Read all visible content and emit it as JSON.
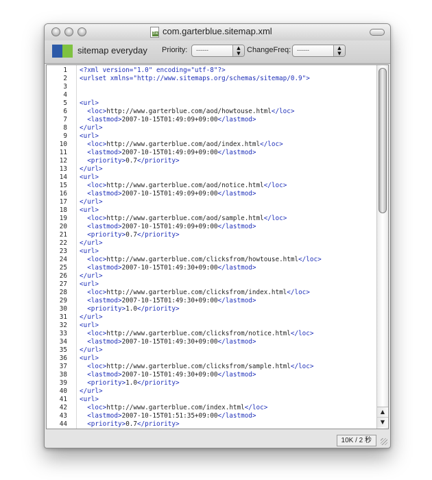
{
  "window": {
    "title": "com.garterblue.sitemap.xml",
    "doc_icon_label": "Dw"
  },
  "toolbar": {
    "app_name": "sitemap everyday",
    "priority_label": "Priority:",
    "priority_value": "------",
    "changefreq_label": "ChangeFreq:",
    "changefreq_value": "------"
  },
  "colors": {
    "logo_blue": "#2d5aa8",
    "logo_green": "#7fc241",
    "xml_tag": "#1d2fb8"
  },
  "editor": {
    "line_numbers": [
      "1",
      "2",
      "3",
      "4",
      "5",
      "6",
      "7",
      "8",
      "9",
      "10",
      "11",
      "12",
      "13",
      "14",
      "15",
      "16",
      "17",
      "18",
      "19",
      "20",
      "21",
      "22",
      "23",
      "24",
      "25",
      "26",
      "27",
      "28",
      "29",
      "30",
      "31",
      "32",
      "33",
      "34",
      "35",
      "36",
      "37",
      "38",
      "39",
      "40",
      "41",
      "42",
      "43",
      "44"
    ],
    "lines": [
      "<?xml version=\"1.0\" encoding=\"utf-8\"?>",
      "<urlset xmlns=\"http://www.sitemaps.org/schemas/sitemap/0.9\">",
      "",
      "",
      "<url>",
      "  <loc>http://www.garterblue.com/aod/howtouse.html</loc>",
      "  <lastmod>2007-10-15T01:49:09+09:00</lastmod>",
      "</url>",
      "<url>",
      "  <loc>http://www.garterblue.com/aod/index.html</loc>",
      "  <lastmod>2007-10-15T01:49:09+09:00</lastmod>",
      "  <priority>0.7</priority>",
      "</url>",
      "<url>",
      "  <loc>http://www.garterblue.com/aod/notice.html</loc>",
      "  <lastmod>2007-10-15T01:49:09+09:00</lastmod>",
      "</url>",
      "<url>",
      "  <loc>http://www.garterblue.com/aod/sample.html</loc>",
      "  <lastmod>2007-10-15T01:49:09+09:00</lastmod>",
      "  <priority>0.7</priority>",
      "</url>",
      "<url>",
      "  <loc>http://www.garterblue.com/clicksfrom/howtouse.html</loc>",
      "  <lastmod>2007-10-15T01:49:30+09:00</lastmod>",
      "</url>",
      "<url>",
      "  <loc>http://www.garterblue.com/clicksfrom/index.html</loc>",
      "  <lastmod>2007-10-15T01:49:30+09:00</lastmod>",
      "  <priority>1.0</priority>",
      "</url>",
      "<url>",
      "  <loc>http://www.garterblue.com/clicksfrom/notice.html</loc>",
      "  <lastmod>2007-10-15T01:49:30+09:00</lastmod>",
      "</url>",
      "<url>",
      "  <loc>http://www.garterblue.com/clicksfrom/sample.html</loc>",
      "  <lastmod>2007-10-15T01:49:30+09:00</lastmod>",
      "  <priority>1.0</priority>",
      "</url>",
      "<url>",
      "  <loc>http://www.garterblue.com/index.html</loc>",
      "  <lastmod>2007-10-15T01:51:35+09:00</lastmod>",
      "  <priority>0.7</priority>"
    ]
  },
  "scrollbar": {
    "up_arrow": "▲",
    "down_arrow": "▼"
  },
  "status": {
    "text": "10K / 2 秒"
  }
}
